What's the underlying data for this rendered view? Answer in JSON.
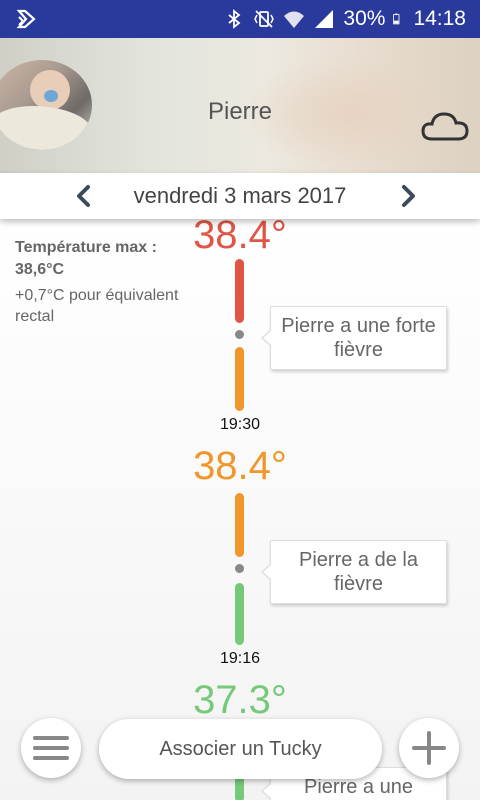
{
  "status_bar": {
    "battery": "30%",
    "time": "14:18",
    "icons": [
      "notification-icon",
      "bluetooth-icon",
      "vibrate-icon",
      "wifi-icon",
      "signal-icon",
      "battery-icon"
    ]
  },
  "header": {
    "child_name": "Pierre",
    "cloud_icon": "cloud-icon"
  },
  "date_nav": {
    "date": "vendredi 3 mars 2017",
    "prev_icon": "chevron-left-icon",
    "next_icon": "chevron-right-icon"
  },
  "summary": {
    "title": "Température max :",
    "value": "38,6°C",
    "note": "+0,7°C pour équivalent rectal"
  },
  "timeline": {
    "readings": [
      {
        "temp": "38.4°",
        "color": "#e05545"
      },
      {
        "time": "19:30",
        "temp": "38.4°",
        "color": "#f0962a"
      },
      {
        "time": "19:16",
        "temp": "37.3°",
        "color": "#77c97a"
      }
    ],
    "messages": [
      "Pierre a une forte fièvre",
      "Pierre a de la fièvre",
      "Pierre a une"
    ]
  },
  "bottom": {
    "menu_icon": "hamburger-menu-icon",
    "associate_label": "Associer un Tucky",
    "add_icon": "plus-icon"
  },
  "colors": {
    "status_bar": "#2a3a9c",
    "high_fever": "#e05545",
    "fever": "#f0962a",
    "normal": "#77c97a"
  }
}
